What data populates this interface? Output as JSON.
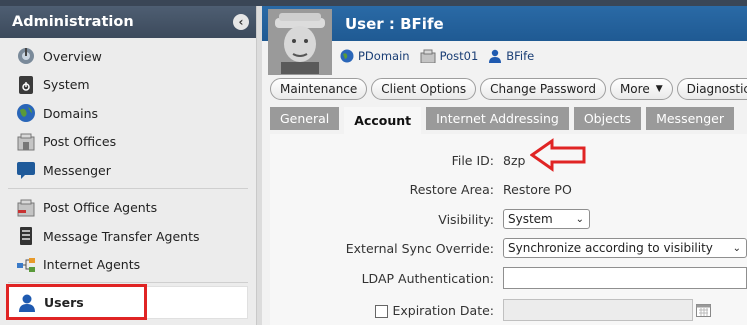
{
  "sidebar": {
    "title": "Administration",
    "group1": [
      {
        "label": "Overview",
        "icon": "overview-icon"
      },
      {
        "label": "System",
        "icon": "system-icon"
      },
      {
        "label": "Domains",
        "icon": "globe-icon"
      },
      {
        "label": "Post Offices",
        "icon": "post-office-icon"
      },
      {
        "label": "Messenger",
        "icon": "messenger-icon"
      }
    ],
    "group2": [
      {
        "label": "Post Office Agents",
        "icon": "post-office-agent-icon"
      },
      {
        "label": "Message Transfer Agents",
        "icon": "mta-icon"
      },
      {
        "label": "Internet Agents",
        "icon": "internet-agent-icon"
      }
    ],
    "active": {
      "label": "Users",
      "icon": "user-icon"
    }
  },
  "header": {
    "title": "User : BFife"
  },
  "breadcrumbs": [
    {
      "label": "PDomain",
      "icon": "globe-icon"
    },
    {
      "label": "Post01",
      "icon": "post-office-icon"
    },
    {
      "label": "BFife",
      "icon": "user-icon"
    }
  ],
  "actions": [
    {
      "label": "Maintenance",
      "dropdown": false
    },
    {
      "label": "Client Options",
      "dropdown": false
    },
    {
      "label": "Change Password",
      "dropdown": false
    },
    {
      "label": "More",
      "dropdown": true
    },
    {
      "label": "Diagnostics",
      "dropdown": true
    }
  ],
  "tabs": [
    {
      "label": "General",
      "active": false
    },
    {
      "label": "Account",
      "active": true
    },
    {
      "label": "Internet Addressing",
      "active": false
    },
    {
      "label": "Objects",
      "active": false
    },
    {
      "label": "Messenger",
      "active": false
    }
  ],
  "form": {
    "file_id_label": "File ID:",
    "file_id_value": "8zp",
    "restore_area_label": "Restore Area:",
    "restore_area_value": "Restore PO",
    "visibility_label": "Visibility:",
    "visibility_value": "System",
    "sync_label": "External Sync Override:",
    "sync_value": "Synchronize according to visibility",
    "ldap_label": "LDAP Authentication:",
    "ldap_value": "",
    "expiration_label": "Expiration Date:",
    "expiration_value": ""
  },
  "colors": {
    "accent": "#1f5a93",
    "highlight": "#e02424"
  }
}
